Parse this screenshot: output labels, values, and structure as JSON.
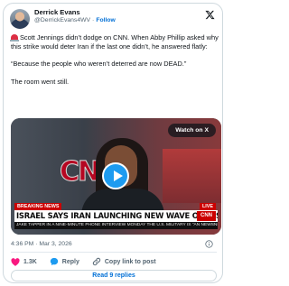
{
  "author": {
    "name": "Derrick Evans",
    "handle": "@DerrickEvans4WV",
    "separator": "·",
    "follow_label": "Follow"
  },
  "tweet": {
    "line1": "Scott Jennings didn’t dodge on CNN. When Abby Phillip asked why this strike would deter Iran if the last one didn’t, he answered flatly:",
    "line2": "“Because the people who weren’t deterred are now DEAD.”",
    "line3": "The room went still."
  },
  "media": {
    "watch_label": "Watch on X",
    "breaking_label": "BREAKING NEWS",
    "live_label": "LIVE",
    "headline": "ISRAEL SAYS IRAN LAUNCHING NEW WAVE OF MISSILES IN WAR",
    "bug_label": "CNN",
    "ticker": "JAKE TAPPER IN A NINE-MINUTE PHONE INTERVIEW MONDAY THE U.S. MILITARY IS \"AN NEWSNIGHT"
  },
  "meta": {
    "timestamp": "4:36 PM · Mar 3, 2026"
  },
  "actions": {
    "likes": "1.3K",
    "reply_label": "Reply",
    "copy_label": "Copy link to post"
  },
  "replies_button": "Read 9 replies",
  "colors": {
    "like": "#f91880",
    "link": "#006fd6",
    "play": "#1d9bf0"
  }
}
